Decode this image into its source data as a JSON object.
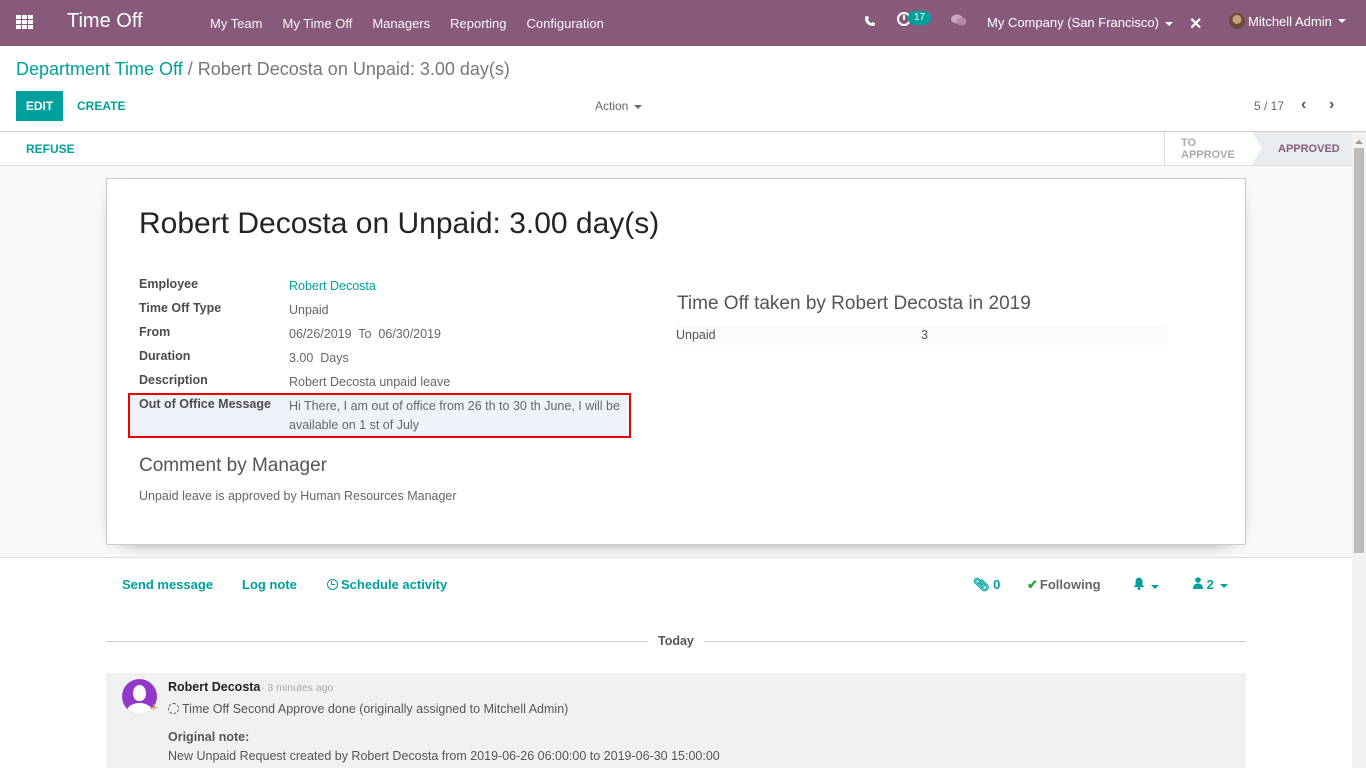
{
  "navbar": {
    "app_title": "Time Off",
    "menu": [
      "My Team",
      "My Time Off",
      "Managers",
      "Reporting",
      "Configuration"
    ],
    "activity_count": "17",
    "company": "My Company (San Francisco)",
    "user": "Mitchell Admin"
  },
  "breadcrumb": {
    "parent": "Department Time Off",
    "separator": "/",
    "current": "Robert Decosta on Unpaid: 3.00 day(s)"
  },
  "toolbar": {
    "edit_label": "EDIT",
    "create_label": "CREATE",
    "action_label": "Action",
    "pager": "5 / 17"
  },
  "statusbar": {
    "refuse_label": "REFUSE",
    "stages": [
      "TO APPROVE",
      "APPROVED"
    ],
    "active_stage": "APPROVED"
  },
  "form": {
    "title": "Robert Decosta on Unpaid: 3.00 day(s)",
    "fields": [
      {
        "label": "Employee",
        "value": "Robert Decosta"
      },
      {
        "label": "Time Off Type",
        "value": "Unpaid"
      },
      {
        "label": "From",
        "value": "06/26/2019  To  06/30/2019"
      },
      {
        "label": "Duration",
        "value": "3.00  Days"
      },
      {
        "label": "Description",
        "value": "Robert Decosta unpaid leave"
      },
      {
        "label": "Out of Office Message",
        "value": "Hi There, I am out of office from 26 th to 30 th June, I will be available on 1 st of July"
      }
    ],
    "comment_title": "Comment by Manager",
    "comment_text": "Unpaid leave is approved by Human Resources Manager",
    "summary_title": "Time Off taken by Robert Decosta in 2019",
    "summary_rows": [
      {
        "type": "Unpaid",
        "value": "3"
      }
    ]
  },
  "chatter": {
    "send_message": "Send message",
    "log_note": "Log note",
    "schedule_activity": "Schedule activity",
    "attachments_count": "0",
    "following_label": "Following",
    "followers_count": "2",
    "date_separator": "Today",
    "messages": [
      {
        "author": "Robert Decosta",
        "date": "- 3 minutes ago",
        "body": "Time Off Second Approve done (originally assigned to Mitchell Admin)",
        "note_label": "Original note:",
        "note": "New Unpaid Request created by Robert Decosta from 2019-06-26 06:00:00 to 2019-06-30 15:00:00"
      }
    ]
  },
  "colors": {
    "brand": "#875a7b",
    "accent": "#00a09d",
    "highlight_border": "#ee0000"
  }
}
